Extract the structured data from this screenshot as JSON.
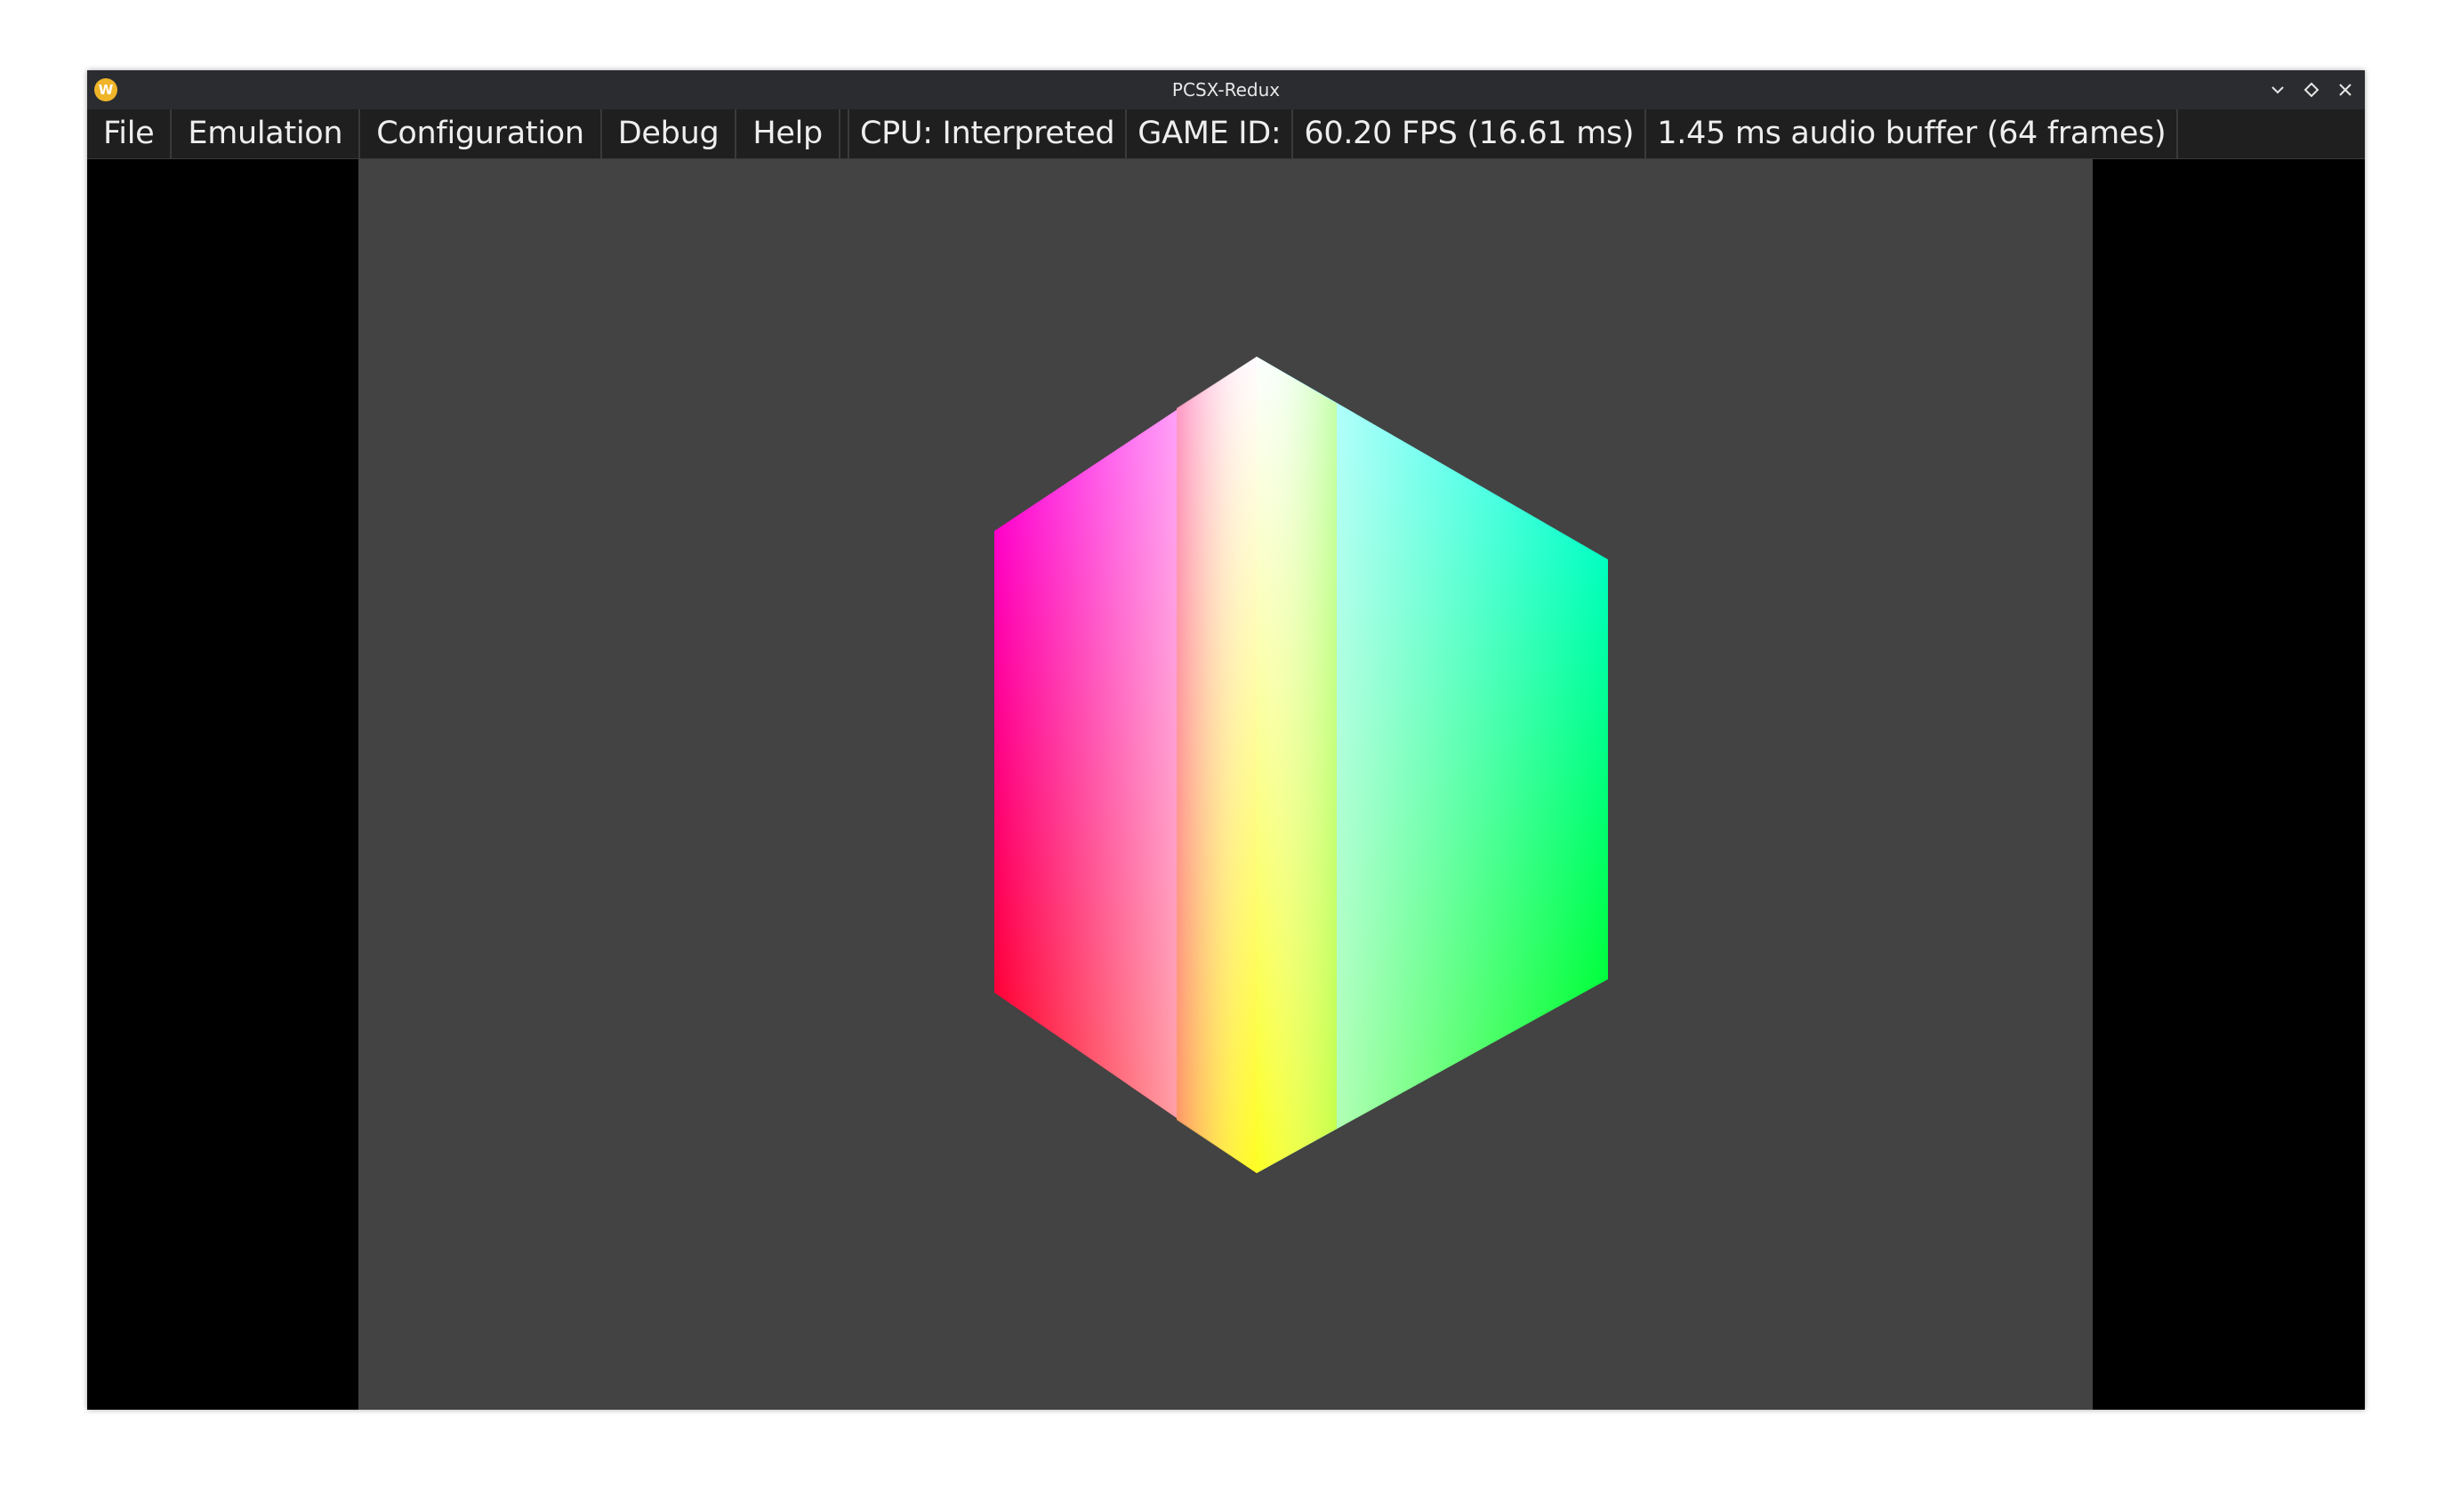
{
  "window": {
    "title": "PCSX-Redux",
    "app_icon_glyph": "W",
    "controls": [
      "minimize-icon",
      "maximize-icon",
      "close-icon"
    ]
  },
  "menu": {
    "items": [
      "File",
      "Emulation",
      "Configuration",
      "Debug",
      "Help"
    ]
  },
  "status": {
    "cpu": "CPU: Interpreted",
    "game_id": "GAME ID:",
    "fps": "60.20 FPS (16.61 ms)",
    "audio": "1.45 ms audio buffer (64 frames)"
  },
  "colors": {
    "titlebar": "#2a2c2f",
    "menubar": "#1f1f1f",
    "screen_bg": "#434343",
    "letterbox": "#000000",
    "app_icon": "#f0b429",
    "cube_top": "#ffffff",
    "cube_left_top": "#ff00ff",
    "cube_left_bottom": "#ff0000",
    "cube_right_top": "#00ffff",
    "cube_right_bottom": "#00ff00",
    "cube_bottom": "#ffff00"
  }
}
